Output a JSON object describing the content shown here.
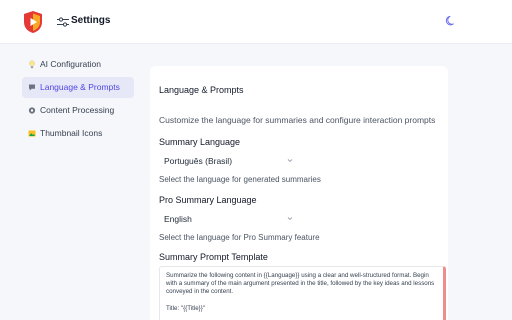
{
  "header": {
    "title": "Settings",
    "logo_icon": "shield-play-logo",
    "settings_icon": "sliders-icon",
    "theme_icon": "moon-icon"
  },
  "sidebar": {
    "items": [
      {
        "label": "AI Configuration",
        "icon": "lightbulb-icon",
        "active": false
      },
      {
        "label": "Language & Prompts",
        "icon": "chat-bubble-icon",
        "active": true
      },
      {
        "label": "Content Processing",
        "icon": "gear-icon",
        "active": false
      },
      {
        "label": "Thumbnail Icons",
        "icon": "image-icon",
        "active": false
      }
    ]
  },
  "panel": {
    "title": "Language & Prompts",
    "description": "Customize the language for summaries and configure interaction prompts",
    "summary_language": {
      "label": "Summary Language",
      "value": "Português (Brasil)",
      "help": "Select the language for generated summaries"
    },
    "pro_summary_language": {
      "label": "Pro Summary Language",
      "value": "English",
      "help": "Select the language for Pro Summary feature"
    },
    "summary_prompt": {
      "label": "Summary Prompt Template",
      "value": "Summarize the following content in {{Language}} using a clear and well-structured format. Begin with a summary of the main argument presented in the title, followed by the key ideas and lessons conveyed in the content.\n\nTitle: \"{{Title}}\""
    }
  },
  "colors": {
    "accent": "#4f46e5",
    "active_bg": "#e6e8f7",
    "page_bg": "#f6f7fb",
    "scroll_marker": "#ef8c8c"
  }
}
